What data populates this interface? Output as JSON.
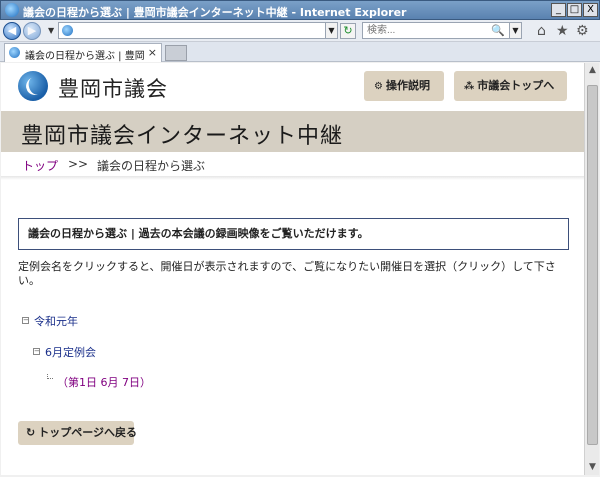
{
  "window": {
    "title": "議会の日程から選ぶ | 豊岡市議会インターネット中継 - Internet Explorer",
    "minimize_glyph": "_",
    "maximize_glyph": "□",
    "close_glyph": "X"
  },
  "toolbar": {
    "search_placeholder": "検索...",
    "back_glyph": "◀",
    "forward_glyph": "▶",
    "dropdown_glyph": "▼",
    "refresh_glyph": "↻",
    "search_glyph": "🔍",
    "home_glyph": "⌂",
    "star_glyph": "★",
    "gear_glyph": "⚙"
  },
  "tabs": [
    {
      "label": "議会の日程から選ぶ | 豊岡...",
      "close_glyph": "×"
    }
  ],
  "site": {
    "name": "豊岡市議会",
    "help_button": "操作説明",
    "help_icon": "⚙",
    "top_button": "市議会トップへ",
    "top_icon": "⁂",
    "banner_title": "豊岡市議会インターネット中継"
  },
  "breadcrumb": {
    "top": "トップ",
    "separator": ">>",
    "current": "議会の日程から選ぶ"
  },
  "notice": "議会の日程から選ぶ | 過去の本会議の録画映像をご覧いただけます。",
  "intro": "定例会名をクリックすると、開催日が表示されますので、ご覧になりたい開催日を選択（クリック）して下さい。",
  "tree": {
    "toggle_glyph": "−",
    "year": "令和元年",
    "session": "6月定例会",
    "day": "（第1日 6月 7日）"
  },
  "back_button": {
    "label": "トップページへ戻る",
    "icon": "↻"
  },
  "scrollbar": {
    "up_glyph": "▲",
    "down_glyph": "▼"
  }
}
